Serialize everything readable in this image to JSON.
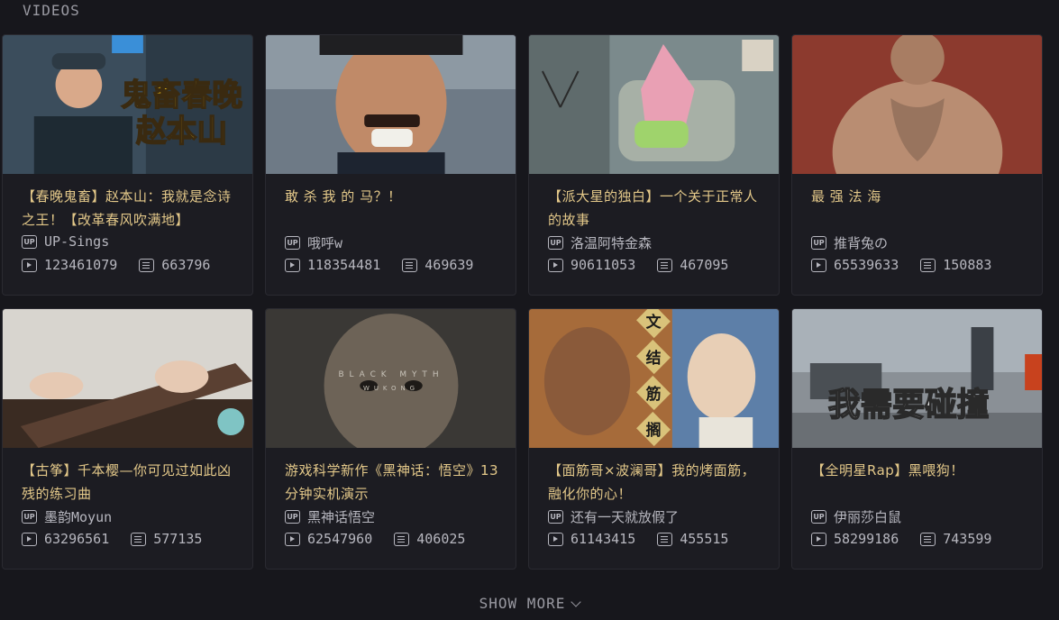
{
  "section": {
    "title": "VIDEOS"
  },
  "videos": [
    {
      "title": "【春晚鬼畜】赵本山：我就是念诗之王！【改革春风吹满地】",
      "up": "UP-Sings",
      "plays": "123461079",
      "danmaku": "663796",
      "thumb_text_1": "鬼畜春晚",
      "thumb_text_2": "赵本山",
      "thumb_colors": [
        "#3b4d5c",
        "#f2c21b"
      ]
    },
    {
      "title": "敢 杀 我 的 马？！",
      "up": "哦呼w",
      "plays": "118354481",
      "danmaku": "469639",
      "thumb_colors": [
        "#6e7a86",
        "#2a2e36"
      ]
    },
    {
      "title": "【派大星的独白】一个关于正常人的故事",
      "up": "洛温阿特金森",
      "plays": "90611053",
      "danmaku": "467095",
      "thumb_colors": [
        "#7b8a8c",
        "#e9a0b4"
      ]
    },
    {
      "title": "最 强 法 海",
      "up": "推背兔の",
      "plays": "65539633",
      "danmaku": "150883",
      "thumb_colors": [
        "#8c3a2e",
        "#b98d72"
      ]
    },
    {
      "title": "【古筝】千本樱—你可见过如此凶残的练习曲",
      "up": "墨韵Moyun",
      "plays": "63296561",
      "danmaku": "577135",
      "thumb_colors": [
        "#d8d5cf",
        "#3a2b22"
      ]
    },
    {
      "title": "游戏科学新作《黑神话：悟空》13分钟实机演示",
      "up": "黑神话悟空",
      "plays": "62547960",
      "danmaku": "406025",
      "thumb_text_1": "BLACK MYTH",
      "thumb_text_2": "WUKONG",
      "thumb_colors": [
        "#3a3835",
        "#6d6357"
      ]
    },
    {
      "title": "【面筋哥×波澜哥】我的烤面筋，融化你的心！",
      "up": "还有一天就放假了",
      "plays": "61143415",
      "danmaku": "455515",
      "thumb_text_1": "文",
      "thumb_text_2": "结",
      "thumb_text_3": "筋",
      "thumb_text_4": "搁",
      "thumb_colors": [
        "#a66b3a",
        "#e8e4da"
      ]
    },
    {
      "title": "【全明星Rap】黑喂狗！",
      "up": "伊丽莎白鼠",
      "plays": "58299186",
      "danmaku": "743599",
      "thumb_text_1": "我需要碰撞",
      "thumb_colors": [
        "#8a9096",
        "#c8421e"
      ]
    }
  ],
  "show_more": {
    "label": "SHOW MORE"
  },
  "icons": {
    "up": "up-icon",
    "plays": "play-icon",
    "danmaku": "danmaku-icon",
    "chevron": "chevron-down-icon"
  }
}
